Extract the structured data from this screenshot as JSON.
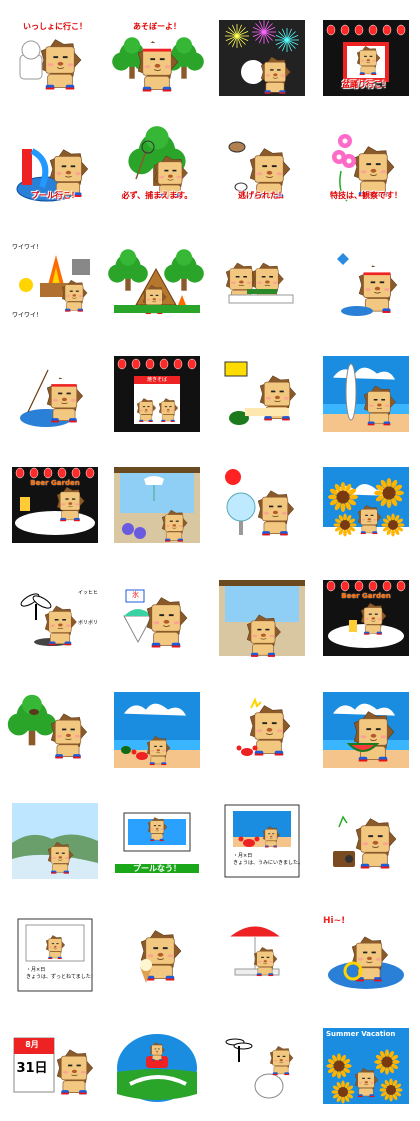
{
  "stickers": [
    {
      "text": "いっしょに行こ！"
    },
    {
      "text": "あそぼーよ！"
    },
    {
      "text": ""
    },
    {
      "text": "盆踊り行こ！"
    },
    {
      "text": "プール行こ！"
    },
    {
      "text": "必ず、捕まえます。"
    },
    {
      "text": "逃げられた！"
    },
    {
      "text": "特技は、観察です！"
    },
    {
      "text": "ワイワイ！",
      "text2": "ワイワイ！"
    },
    {
      "text": ""
    },
    {
      "text": ""
    },
    {
      "text": ""
    },
    {
      "text": ""
    },
    {
      "text": "焼きそば"
    },
    {
      "text": ""
    },
    {
      "text": ""
    },
    {
      "text": "Beer Garden"
    },
    {
      "text": ""
    },
    {
      "text": ""
    },
    {
      "text": ""
    },
    {
      "text": "ボリボリ",
      "text2": "イッヒヒ"
    },
    {
      "text": "氷"
    },
    {
      "text": ""
    },
    {
      "text": "Beer Garden"
    },
    {
      "text": ""
    },
    {
      "text": ""
    },
    {
      "text": ""
    },
    {
      "text": ""
    },
    {
      "text": ""
    },
    {
      "text": "プールなう！"
    },
    {
      "text": "・月×日",
      "text2": "きょうは、うみにいきました。"
    },
    {
      "text": ""
    },
    {
      "text": "・月×日",
      "text2": "きょうは、ずっとねてました！"
    },
    {
      "text": ""
    },
    {
      "text": ""
    },
    {
      "text": "Hi~!"
    },
    {
      "text": "8月",
      "text2": "31日"
    },
    {
      "text": ""
    },
    {
      "text": ""
    },
    {
      "text": "Summer Vacation"
    }
  ]
}
